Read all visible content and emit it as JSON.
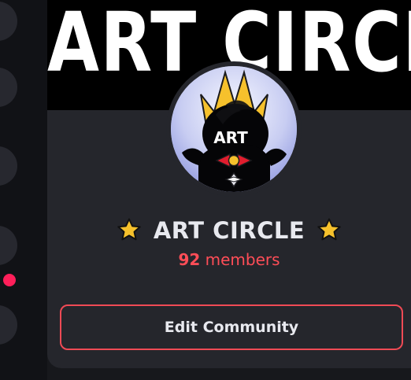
{
  "banner": {
    "text": "ART CIRCLE"
  },
  "community": {
    "name": "ART CIRCLE",
    "avatar_text": "ART",
    "member_count": "92",
    "members_label": "members"
  },
  "actions": {
    "edit_label": "Edit Community"
  },
  "colors": {
    "accent": "#f04a55",
    "members_text": "#ff4d57",
    "card_bg": "#25262c",
    "rail_bg": "#111216",
    "notification_dot": "#ff1f5a",
    "star": "#f6c12c"
  },
  "icons": {
    "left_star": "star-icon",
    "right_star": "star-icon"
  }
}
